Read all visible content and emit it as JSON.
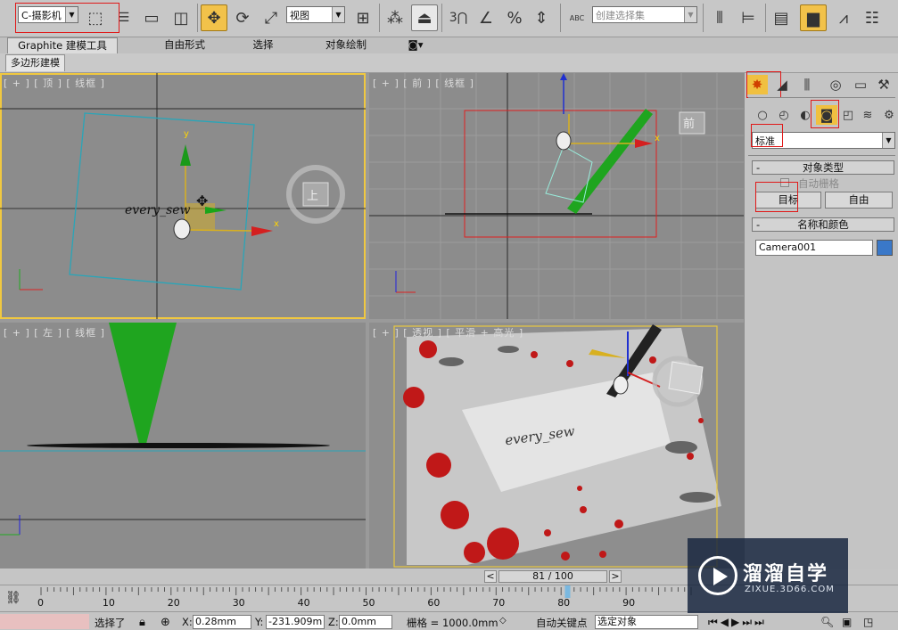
{
  "toolbar": {
    "selection_filter": "C-摄影机",
    "coord_system": "视图",
    "named_selection_placeholder": "创建选择集",
    "snap_label": "3",
    "angle_snap_label": "∠",
    "percent_snap_label": "%",
    "abc_label": "ABC"
  },
  "ribbon": {
    "tabs": [
      "Graphite 建模工具",
      "自由形式",
      "选择",
      "对象绘制"
    ],
    "subtab": "多边形建模"
  },
  "viewports": {
    "top_label": "[ + ] [ 顶 ] [ 线框 ]",
    "front_label": "[ + ] [ 前 ] [ 线框 ]",
    "left_label": "[ + ] [ 左 ] [ 线框 ]",
    "persp_label": "[ + ] [ 透视 ] [ 平滑 + 高光 ]",
    "viewcube_top": "上",
    "viewcube_front": "前",
    "handwriting": "every_sew",
    "axis_x": "x",
    "axis_y": "y",
    "axis_z": "z"
  },
  "command_panel": {
    "dropdown": "标准",
    "rollout_object_type": "对象类型",
    "auto_grid": "自动栅格",
    "btn_target": "目标",
    "btn_free": "自由",
    "rollout_name_color": "名称和颜色",
    "camera_name": "Camera001",
    "object_color": "#3a78c8"
  },
  "time": {
    "frame_display": "81 / 100",
    "prev": "<",
    "next": ">",
    "ticks": [
      "0",
      "10",
      "20",
      "30",
      "40",
      "50",
      "60",
      "70",
      "80",
      "90"
    ],
    "current_frame": 81,
    "total_frames": 100
  },
  "status": {
    "selected": "选择了",
    "x_label": "X:",
    "x_value": "0.28mm",
    "y_label": "Y:",
    "y_value": "-231.909m",
    "z_label": "Z:",
    "z_value": "0.0mm",
    "grid": "栅格 = 1000.0mm",
    "auto_key": "自动关键点",
    "set_key_mode": "选定对象"
  },
  "watermark": {
    "title": "溜溜自学",
    "url": "ZIXUE.3D66.COM"
  }
}
